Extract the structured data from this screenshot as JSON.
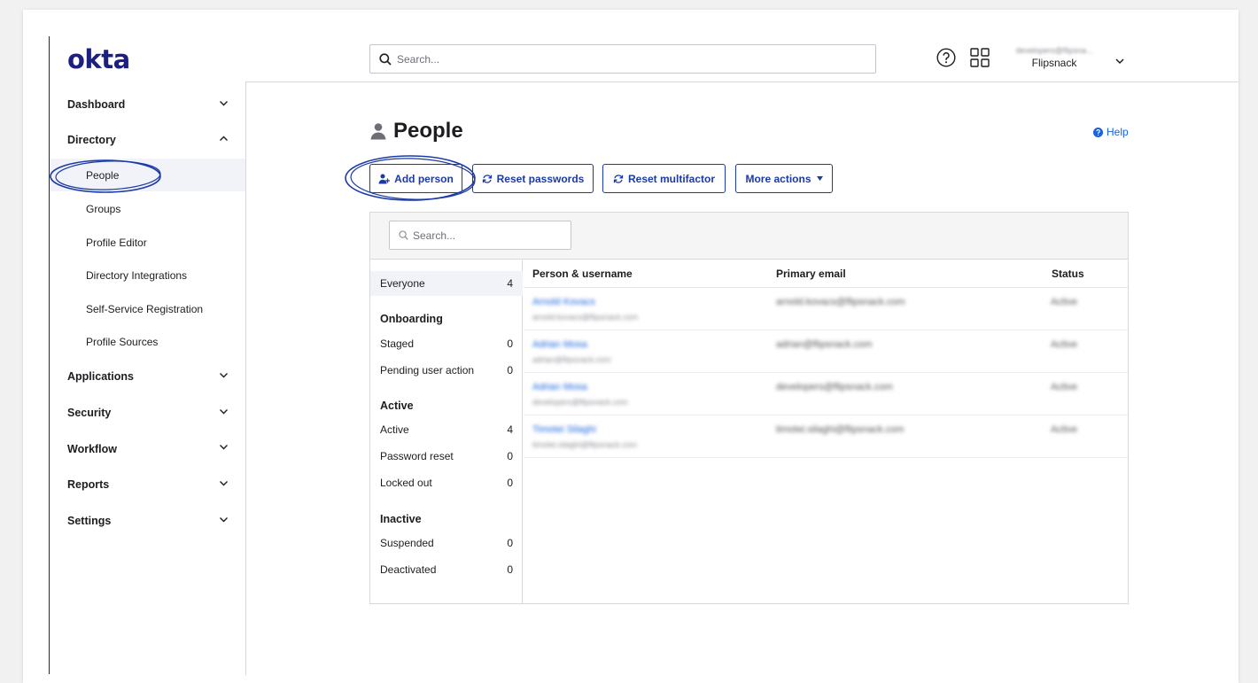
{
  "brand": {
    "logo": "okta",
    "accent": "#1a3aa6",
    "link": "#1662dd"
  },
  "header": {
    "search_placeholder": "Search...",
    "user_email": "developers@flipsna...",
    "user_org": "Flipsnack",
    "icons": [
      "help-circle-icon",
      "app-grid-icon",
      "chevron-down-icon"
    ]
  },
  "sidebar": {
    "sections": [
      {
        "label": "Dashboard",
        "expanded": false
      },
      {
        "label": "Directory",
        "expanded": true
      },
      {
        "label": "Applications",
        "expanded": false
      },
      {
        "label": "Security",
        "expanded": false
      },
      {
        "label": "Workflow",
        "expanded": false
      },
      {
        "label": "Reports",
        "expanded": false
      },
      {
        "label": "Settings",
        "expanded": false
      }
    ],
    "directory_items": [
      {
        "label": "People",
        "active": true
      },
      {
        "label": "Groups"
      },
      {
        "label": "Profile Editor"
      },
      {
        "label": "Directory Integrations"
      },
      {
        "label": "Self-Service Registration"
      },
      {
        "label": "Profile Sources"
      }
    ]
  },
  "page": {
    "title": "People",
    "help_label": "Help",
    "actions": {
      "add_person": "Add person",
      "reset_passwords": "Reset passwords",
      "reset_multifactor": "Reset multifactor",
      "more_actions": "More actions"
    },
    "panel_search_placeholder": "Search..."
  },
  "filters": {
    "everyone": {
      "label": "Everyone",
      "count": "4"
    },
    "groups": [
      {
        "heading": "Onboarding",
        "items": [
          {
            "label": "Staged",
            "count": "0"
          },
          {
            "label": "Pending user action",
            "count": "0"
          }
        ]
      },
      {
        "heading": "Active",
        "items": [
          {
            "label": "Active",
            "count": "4"
          },
          {
            "label": "Password reset",
            "count": "0"
          },
          {
            "label": "Locked out",
            "count": "0"
          }
        ]
      },
      {
        "heading": "Inactive",
        "items": [
          {
            "label": "Suspended",
            "count": "0"
          },
          {
            "label": "Deactivated",
            "count": "0"
          }
        ]
      }
    ]
  },
  "table": {
    "columns": [
      "Person & username",
      "Primary email",
      "Status"
    ],
    "rows": [
      {
        "name": "Arnold Kovacs",
        "username": "arnold.kovacs@flipsnack.com",
        "email": "arnold.kovacs@flipsnack.com",
        "status": "Active"
      },
      {
        "name": "Adrian Mosa",
        "username": "adrian@flipsnack.com",
        "email": "adrian@flipsnack.com",
        "status": "Active"
      },
      {
        "name": "Adrian Mosa",
        "username": "developers@flipsnack.com",
        "email": "developers@flipsnack.com",
        "status": "Active"
      },
      {
        "name": "Timotei Silaghi",
        "username": "timotei.silaghi@flipsnack.com",
        "email": "timotei.silaghi@flipsnack.com",
        "status": "Active"
      }
    ]
  }
}
